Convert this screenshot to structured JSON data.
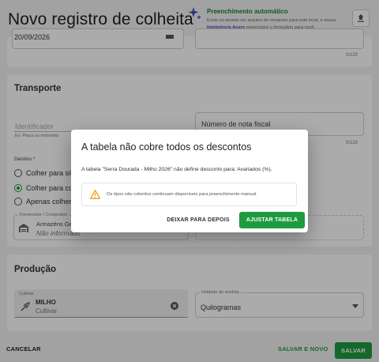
{
  "header": {
    "title": "Novo registro de colheita",
    "auto_fill": {
      "title": "Preenchimento automático",
      "desc_part1": "Envie ou arraste um arquivo de romaneio para este local, e nossa ",
      "desc_ai": "Inteligência Aegro",
      "desc_part2": " preencherá o formulário para você."
    }
  },
  "top_section": {
    "date_value": "20/09/2026",
    "counter": "0/120"
  },
  "transporte": {
    "title": "Transporte",
    "identificador_placeholder": "Identificador",
    "identificador_hint": "Ex: Placa ou motorista",
    "nota_fiscal_placeholder": "Número de nota fiscal",
    "nota_counter": "0/120",
    "destino_label": "Destino *",
    "destino_options": [
      {
        "label": "Colher para silo",
        "checked": false
      },
      {
        "label": "Colher para comprador",
        "checked": true
      },
      {
        "label": "Apenas colher",
        "checked": false
      }
    ],
    "fornecedor_label": "Fornecedor / Comprador",
    "fornecedor_name": "Armazéns Gerais",
    "fornecedor_sub": "Não informado"
  },
  "producao": {
    "title": "Produção",
    "cultivar_label": "Cultivar",
    "cultivar_name": "MILHO",
    "cultivar_sub": "Cultivar",
    "unidade_label": "Unidade de medida",
    "unidade_value": "Quilogramas"
  },
  "dialog": {
    "title": "A tabela não cobre todos os descontos",
    "text": "A tabela \"Serra Dourada - Milho 2026\" não define desconto para: Avariados (%).",
    "warning": "Os tipos não cobertos continuam disponíveis para preenchimento manual.",
    "later_label": "DEIXAR PARA DEPOIS",
    "adjust_label": "AJUSTAR TABELA"
  },
  "footer": {
    "cancel_label": "CANCELAR",
    "save_new_label": "SALVAR E NOVO",
    "save_label": "SALVAR"
  },
  "colors": {
    "primary": "#1e9b3f",
    "ai_purple": "#6a3fb8",
    "warning": "#f0a020"
  }
}
